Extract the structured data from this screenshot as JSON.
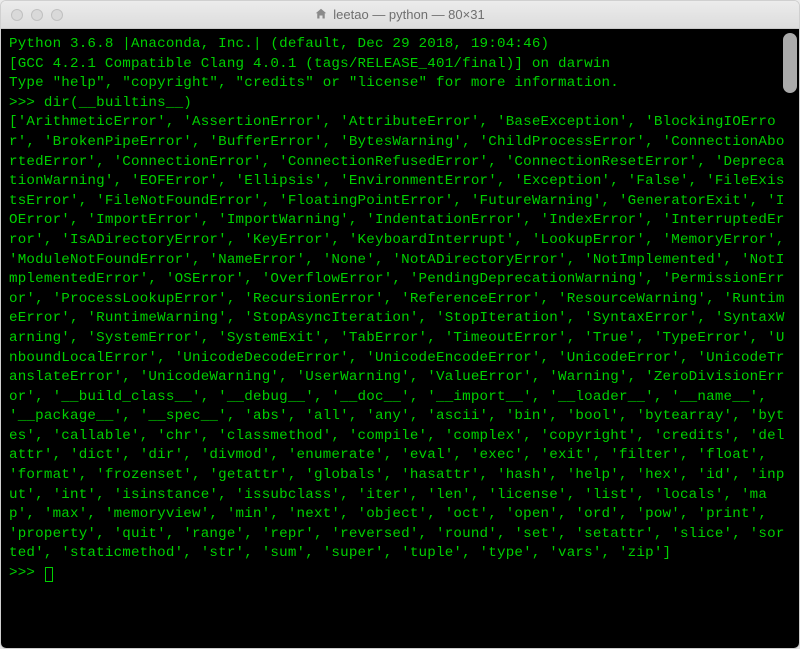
{
  "window": {
    "title": "leetao — python — 80×31"
  },
  "terminal": {
    "banner_line_1": "Python 3.6.8 |Anaconda, Inc.| (default, Dec 29 2018, 19:04:46)",
    "banner_line_2": "[GCC 4.2.1 Compatible Clang 4.0.1 (tags/RELEASE_401/final)] on darwin",
    "banner_line_3": "Type \"help\", \"copyright\", \"credits\" or \"license\" for more information.",
    "prompt": ">>> ",
    "command": "dir(__builtins__)",
    "output": "['ArithmeticError', 'AssertionError', 'AttributeError', 'BaseException', 'BlockingIOError', 'BrokenPipeError', 'BufferError', 'BytesWarning', 'ChildProcessError', 'ConnectionAbortedError', 'ConnectionError', 'ConnectionRefusedError', 'ConnectionResetError', 'DeprecationWarning', 'EOFError', 'Ellipsis', 'EnvironmentError', 'Exception', 'False', 'FileExistsError', 'FileNotFoundError', 'FloatingPointError', 'FutureWarning', 'GeneratorExit', 'IOError', 'ImportError', 'ImportWarning', 'IndentationError', 'IndexError', 'InterruptedError', 'IsADirectoryError', 'KeyError', 'KeyboardInterrupt', 'LookupError', 'MemoryError', 'ModuleNotFoundError', 'NameError', 'None', 'NotADirectoryError', 'NotImplemented', 'NotImplementedError', 'OSError', 'OverflowError', 'PendingDeprecationWarning', 'PermissionError', 'ProcessLookupError', 'RecursionError', 'ReferenceError', 'ResourceWarning', 'RuntimeError', 'RuntimeWarning', 'StopAsyncIteration', 'StopIteration', 'SyntaxError', 'SyntaxWarning', 'SystemError', 'SystemExit', 'TabError', 'TimeoutError', 'True', 'TypeError', 'UnboundLocalError', 'UnicodeDecodeError', 'UnicodeEncodeError', 'UnicodeError', 'UnicodeTranslateError', 'UnicodeWarning', 'UserWarning', 'ValueError', 'Warning', 'ZeroDivisionError', '__build_class__', '__debug__', '__doc__', '__import__', '__loader__', '__name__', '__package__', '__spec__', 'abs', 'all', 'any', 'ascii', 'bin', 'bool', 'bytearray', 'bytes', 'callable', 'chr', 'classmethod', 'compile', 'complex', 'copyright', 'credits', 'delattr', 'dict', 'dir', 'divmod', 'enumerate', 'eval', 'exec', 'exit', 'filter', 'float', 'format', 'frozenset', 'getattr', 'globals', 'hasattr', 'hash', 'help', 'hex', 'id', 'input', 'int', 'isinstance', 'issubclass', 'iter', 'len', 'license', 'list', 'locals', 'map', 'max', 'memoryview', 'min', 'next', 'object', 'oct', 'open', 'ord', 'pow', 'print', 'property', 'quit', 'range', 'repr', 'reversed', 'round', 'set', 'setattr', 'slice', 'sorted', 'staticmethod', 'str', 'sum', 'super', 'tuple', 'type', 'vars', 'zip']"
  }
}
